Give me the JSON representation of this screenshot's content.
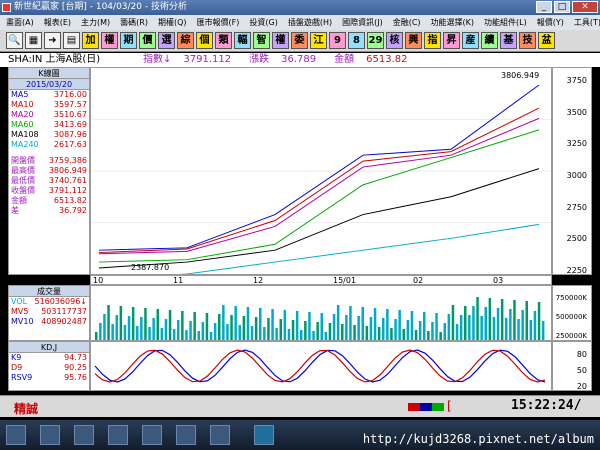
{
  "window": {
    "title": "新世紀贏家 [台期] - 104/03/20 - 技術分析"
  },
  "menu": [
    "畫面(A)",
    "報表(E)",
    "主力(M)",
    "籌碼(R)",
    "期權(Q)",
    "匯市報價(F)",
    "投資(G)",
    "插盤遊戲(H)",
    "國際資訊(J)",
    "金融(C)",
    "功能選擇(K)",
    "功能組件(L)",
    "報價(Y)",
    "工具(T)",
    "說明(H)"
  ],
  "toolbar": {
    "icons": [
      "search-icon",
      "grid-icon",
      "arrow-icon",
      "bars-icon"
    ],
    "buttons": [
      "加",
      "權",
      "期",
      "價",
      "選",
      "綜",
      "個",
      "類",
      "輻",
      "智",
      "權",
      "委",
      "江",
      "9",
      "8",
      "29",
      "核",
      "興",
      "指",
      "昇",
      "産",
      "續",
      "基",
      "技",
      "盆"
    ]
  },
  "info": {
    "symbol": "SHA:IN 上海A股(日)",
    "index_label": "指數↓",
    "index_value": "3791.112",
    "change_label": "漲跌",
    "change_value": "36.789",
    "amount_label": "金額",
    "amount_value": "6513.82"
  },
  "kpanel": {
    "title": "K線圖",
    "date": "2015/03/20",
    "ma": [
      {
        "label": "MA5",
        "value": "3716.00",
        "color": "#0000dd"
      },
      {
        "label": "MA10",
        "value": "3597.57",
        "color": "#cc0000"
      },
      {
        "label": "MA20",
        "value": "3510.67",
        "color": "#aa00aa"
      },
      {
        "label": "MA60",
        "value": "3413.69",
        "color": "#00aa00"
      },
      {
        "label": "MA108",
        "value": "3087.96",
        "color": "#000000"
      },
      {
        "label": "MA240",
        "value": "2617.63",
        "color": "#00aacc"
      }
    ],
    "prices": [
      {
        "label": "開盤價",
        "value": "3759.386"
      },
      {
        "label": "最高價",
        "value": "3806.949"
      },
      {
        "label": "最低價",
        "value": "3740.761"
      },
      {
        "label": "收盤價",
        "value": "3791.112"
      },
      {
        "label": "金額",
        "value": "6513.82"
      },
      {
        "label": "差",
        "value": "36.792"
      }
    ],
    "high_mark": "3806.949",
    "low_mark": "2387.870"
  },
  "yaxis": [
    "3750",
    "3500",
    "3250",
    "3000",
    "2750",
    "2500",
    "2250"
  ],
  "xaxis": [
    "10",
    "11",
    "12",
    "15/01",
    "02",
    "03"
  ],
  "volume": {
    "title": "成交量",
    "rows": [
      {
        "label": "VOL",
        "value": "516036096↓",
        "color": "#00aacc"
      },
      {
        "label": "MV5",
        "value": "503117737",
        "color": "#cc0000"
      },
      {
        "label": "MV10",
        "value": "408902487",
        "color": "#0000dd"
      }
    ],
    "axis": [
      "750000K",
      "500000K",
      "250000K"
    ]
  },
  "kd": {
    "title": "KD,J",
    "rows": [
      {
        "label": "K9",
        "value": "94.73",
        "color": "#0000dd"
      },
      {
        "label": "D9",
        "value": "90.25",
        "color": "#cc0000"
      },
      {
        "label": "RSV9",
        "value": "95.76",
        "color": "#0000dd"
      }
    ],
    "axis": [
      "80",
      "50",
      "20"
    ]
  },
  "status": {
    "brand": "精誠",
    "bracket": "[",
    "time": "15:22:24/"
  },
  "watermark": "http://kujd3268.pixnet.net/album",
  "chart_data": {
    "type": "line",
    "title": "SHA:IN 上海A股(日)",
    "x": [
      "10",
      "11",
      "12",
      "15/01",
      "02",
      "03"
    ],
    "ylim": [
      2250,
      3850
    ],
    "series": [
      {
        "name": "MA5",
        "values": [
          2400,
          2420,
          2700,
          3200,
          3250,
          3791
        ]
      },
      {
        "name": "MA10",
        "values": [
          2380,
          2410,
          2650,
          3150,
          3230,
          3597
        ]
      },
      {
        "name": "MA20",
        "values": [
          2370,
          2390,
          2600,
          3100,
          3200,
          3510
        ]
      },
      {
        "name": "MA60",
        "values": [
          2300,
          2320,
          2450,
          2950,
          3180,
          3413
        ]
      },
      {
        "name": "MA108",
        "values": [
          2250,
          2300,
          2400,
          2700,
          2850,
          3087
        ]
      },
      {
        "name": "MA240",
        "values": [
          2150,
          2200,
          2300,
          2400,
          2500,
          2617
        ]
      }
    ]
  }
}
